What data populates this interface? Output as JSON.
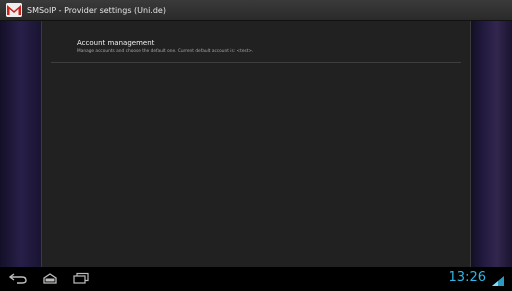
{
  "app": {
    "title": "SMSoIP - Provider settings (Uni.de)",
    "icon": "gmail-envelope-icon"
  },
  "preferences": [
    {
      "title": "Account management",
      "summary": "Manage accounts and choose the default one. Current default account is: <test>."
    }
  ],
  "navigation": {
    "back": "back-icon",
    "home": "home-icon",
    "recents": "recent-apps-icon"
  },
  "status_bar": {
    "time": "13:26",
    "clock_color": "#33b5e5",
    "icons": [
      "wifi-icon",
      "signal-icon"
    ]
  }
}
